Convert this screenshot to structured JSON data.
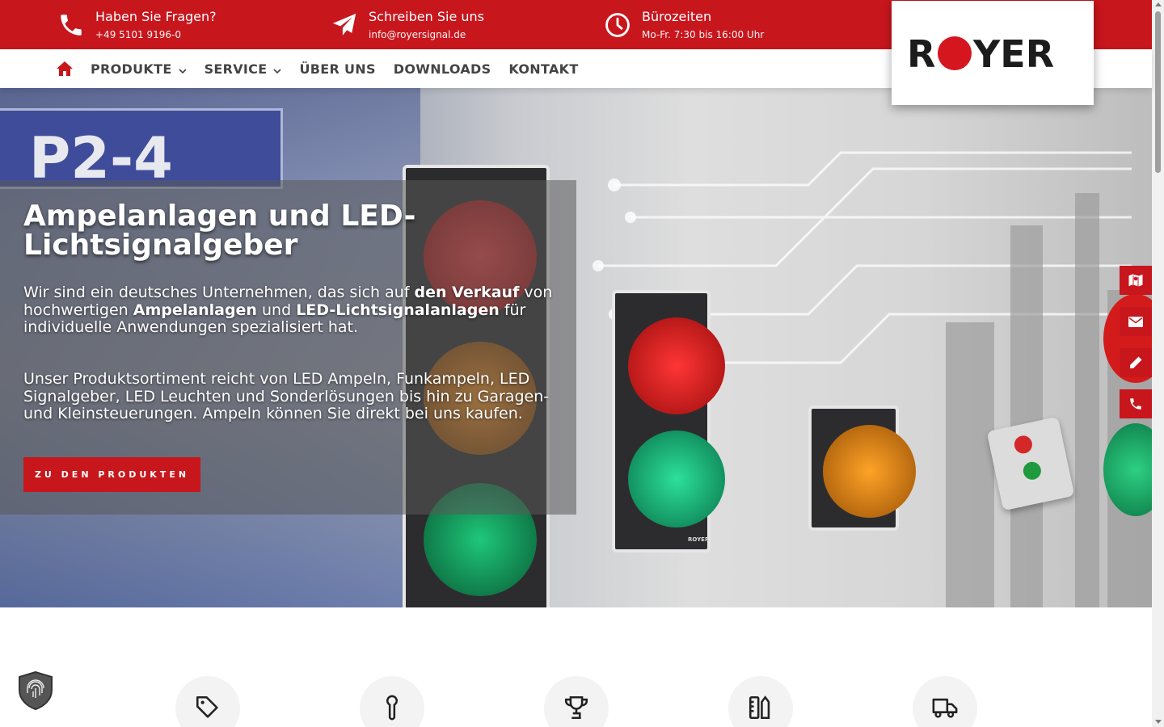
{
  "topbar": {
    "items": [
      {
        "title": "Haben Sie Fragen?",
        "detail": "+49 5101 9196-0",
        "icon": "phone-icon"
      },
      {
        "title": "Schreiben Sie uns",
        "detail": "info@royersignal.de",
        "icon": "paper-plane-icon"
      },
      {
        "title": "Bürozeiten",
        "detail": "Mo-Fr. 7:30 bis 16:00 Uhr",
        "icon": "clock-icon"
      }
    ]
  },
  "logo": {
    "text": "ROYER"
  },
  "nav": {
    "items": [
      {
        "label": "PRODUKTE",
        "has_dropdown": true
      },
      {
        "label": "SERVICE",
        "has_dropdown": true
      },
      {
        "label": "ÜBER UNS",
        "has_dropdown": false
      },
      {
        "label": "DOWNLOADS",
        "has_dropdown": false
      },
      {
        "label": "KONTAKT",
        "has_dropdown": false
      }
    ]
  },
  "hero": {
    "sign_text": "P2-4",
    "title": "Ampelanlagen und LED-Lichtsignalgeber",
    "p1": {
      "t1": "Wir sind ein deutsches Unternehmen, das sich auf ",
      "b1": "den Verkauf",
      "t2": " von hochwertigen ",
      "b2": "Ampelanlagen",
      "t3": " und ",
      "b3": "LED-Lichtsignalanlagen",
      "t4": " für individuelle Anwendungen spezialisiert hat."
    },
    "p2": "Unser Produktsortiment reicht von LED Ampeln, Funkampeln, LED Signalgeber, LED Leuchten und Sonderlösungen bis hin zu Garagen- und Kleinsteuerungen. Ampeln können Sie direkt bei uns kaufen.",
    "cta": "ZU DEN PRODUKTEN",
    "device_label": "ROYER"
  },
  "side_buttons": [
    "map-icon",
    "mail-icon",
    "pencil-icon",
    "phone-icon"
  ],
  "features": [
    "tag-icon",
    "wrench-icon",
    "trophy-icon",
    "tools-icon",
    "truck-icon"
  ],
  "colors": {
    "brand_red": "#c8161d",
    "nav_text": "#444444"
  }
}
